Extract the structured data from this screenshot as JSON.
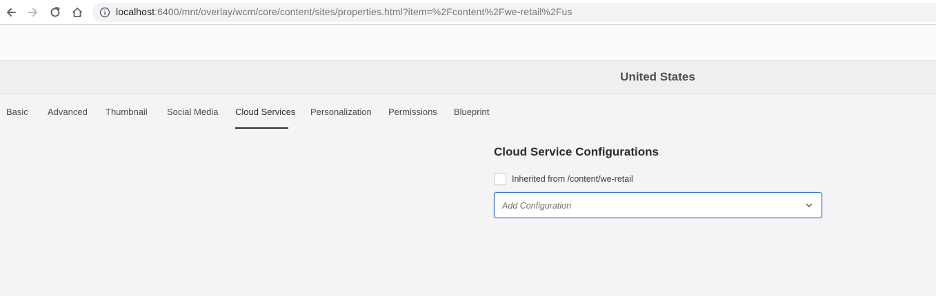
{
  "browser": {
    "url_host": "localhost",
    "url_rest": ":6400/mnt/overlay/wcm/core/content/sites/properties.html?item=%2Fcontent%2Fwe-retail%2Fus",
    "icons": [
      "back-arrow-icon",
      "forward-arrow-icon",
      "reload-icon",
      "home-icon",
      "info-icon"
    ]
  },
  "header": {
    "title": "United States"
  },
  "tabs": [
    {
      "label": "Basic"
    },
    {
      "label": "Advanced"
    },
    {
      "label": "Thumbnail"
    },
    {
      "label": "Social Media"
    },
    {
      "label": "Cloud Services",
      "active": true
    },
    {
      "label": "Personalization"
    },
    {
      "label": "Permissions"
    },
    {
      "label": "Blueprint"
    }
  ],
  "cloud": {
    "section_title": "Cloud Service Configurations",
    "inherited_label": "Inherited from /content/we-retail",
    "inherited_checked": false,
    "select_placeholder": "Add Configuration"
  },
  "colors": {
    "accent": "#326ec8",
    "background": "#f4f4f4"
  }
}
